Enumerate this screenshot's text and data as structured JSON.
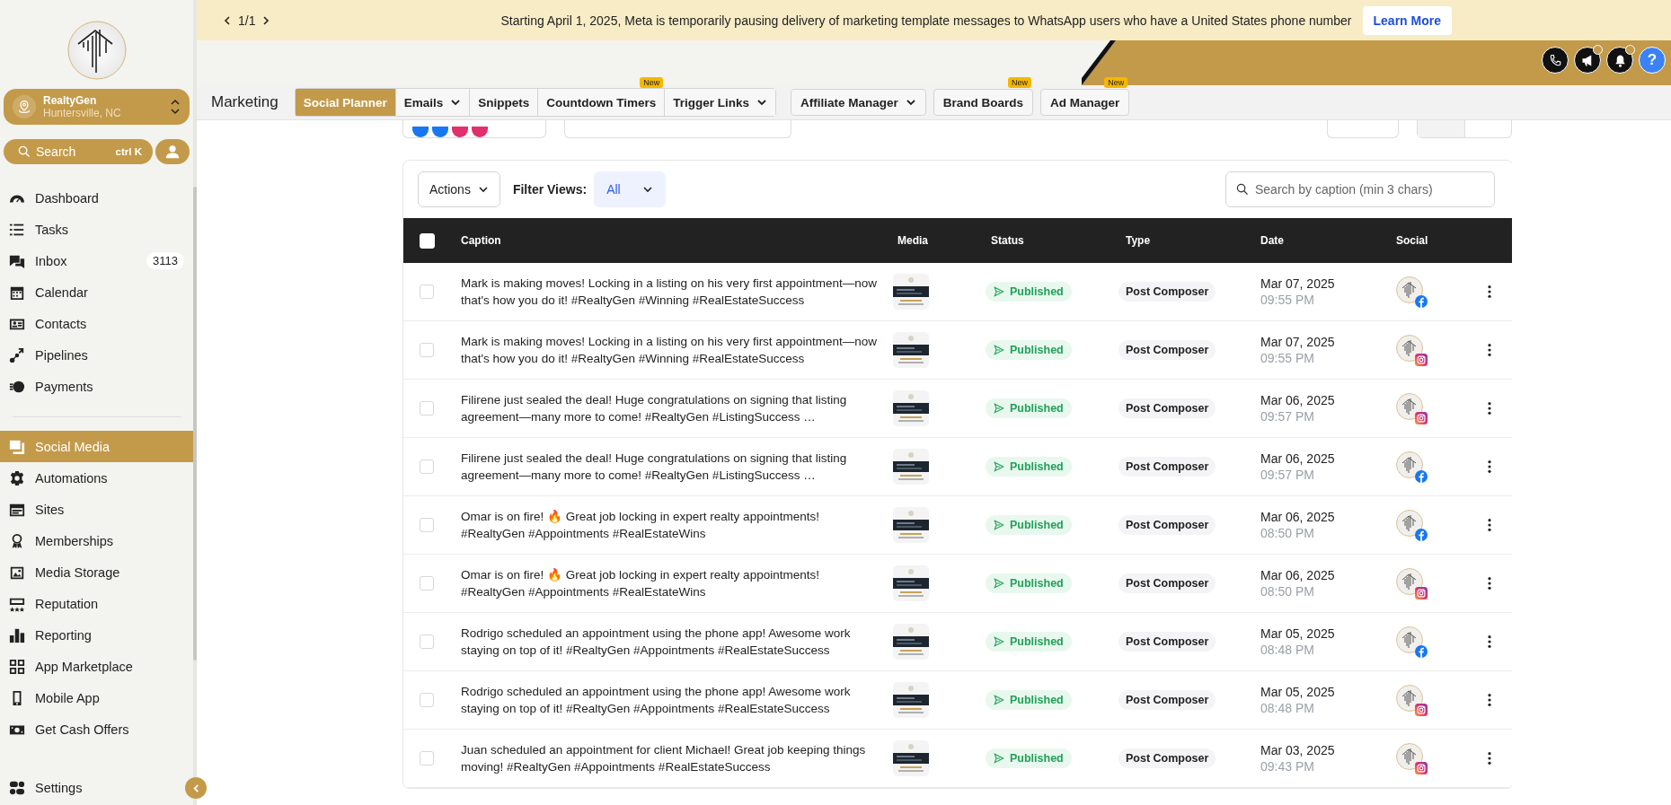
{
  "banner": {
    "pager": "1/1",
    "message": "Starting April 1, 2025, Meta is temporarily pausing delivery of marketing template messages to WhatsApp users who have a United States phone number",
    "button": "Learn More"
  },
  "sidebar": {
    "account": {
      "name": "RealtyGen",
      "location": "Huntersville, NC"
    },
    "search": {
      "placeholder": "Search",
      "shortcut": "ctrl K"
    },
    "main_items": [
      {
        "label": "Dashboard",
        "selected": false
      },
      {
        "label": "Tasks",
        "selected": false
      },
      {
        "label": "Inbox",
        "selected": false,
        "badge": "3113"
      },
      {
        "label": "Calendar",
        "selected": false
      },
      {
        "label": "Contacts",
        "selected": false
      },
      {
        "label": "Pipelines",
        "selected": false
      },
      {
        "label": "Payments",
        "selected": false
      }
    ],
    "more_items": [
      {
        "label": "Social Media",
        "selected": true
      },
      {
        "label": "Automations",
        "selected": false
      },
      {
        "label": "Sites",
        "selected": false
      },
      {
        "label": "Memberships",
        "selected": false
      },
      {
        "label": "Media Storage",
        "selected": false
      },
      {
        "label": "Reputation",
        "selected": false
      },
      {
        "label": "Reporting",
        "selected": false
      },
      {
        "label": "App Marketplace",
        "selected": false
      },
      {
        "label": "Mobile App",
        "selected": false
      },
      {
        "label": "Get Cash Offers",
        "selected": false
      }
    ],
    "settings": "Settings"
  },
  "header_icons": [
    {
      "kind": "phone",
      "dot": false
    },
    {
      "kind": "megaphone",
      "dot": true
    },
    {
      "kind": "bell",
      "dot": true
    },
    {
      "kind": "help",
      "label": "?"
    }
  ],
  "page_title": "Marketing",
  "tabs": [
    {
      "label": "Social Planner",
      "selected": true,
      "dropdown": false,
      "kind": "segment"
    },
    {
      "label": "Emails",
      "selected": false,
      "dropdown": true,
      "kind": "segment"
    },
    {
      "label": "Snippets",
      "selected": false,
      "dropdown": false,
      "kind": "segment"
    },
    {
      "label": "Countdown Timers",
      "selected": false,
      "dropdown": false,
      "kind": "segment",
      "badge": "New"
    },
    {
      "label": "Trigger Links",
      "selected": false,
      "dropdown": true,
      "kind": "segment"
    },
    {
      "label": "Affiliate Manager",
      "selected": false,
      "dropdown": true,
      "kind": "button"
    },
    {
      "label": "Brand Boards",
      "selected": false,
      "dropdown": false,
      "kind": "button",
      "badge": "New"
    },
    {
      "label": "Ad Manager",
      "selected": false,
      "dropdown": false,
      "kind": "button",
      "badge": "New"
    }
  ],
  "toolbar": {
    "actions": "Actions",
    "filter_label": "Filter Views:",
    "filter_value": "All",
    "search_placeholder": "Search by caption (min 3 chars)"
  },
  "table": {
    "header_checked": false,
    "columns": [
      "Caption",
      "Media",
      "Status",
      "Type",
      "Date",
      "Social"
    ],
    "rows": [
      {
        "checked": false,
        "caption": "Mark is making moves! Locking in a listing on his very first appointment—now that's how you do it! #RealtyGen #Winning #RealEstateSuccess",
        "status": "Published",
        "type": "Post Composer",
        "date": "Mar 07, 2025",
        "time": "09:55 PM",
        "kind": "facebook"
      },
      {
        "checked": false,
        "caption": "Mark is making moves! Locking in a listing on his very first appointment—now that's how you do it! #RealtyGen #Winning #RealEstateSuccess",
        "status": "Published",
        "type": "Post Composer",
        "date": "Mar 07, 2025",
        "time": "09:55 PM",
        "kind": "instagram"
      },
      {
        "checked": false,
        "caption": "Filirene just sealed the deal! Huge congratulations on signing that listing agreement—many more to come! #RealtyGen #ListingSuccess …",
        "status": "Published",
        "type": "Post Composer",
        "date": "Mar 06, 2025",
        "time": "09:57 PM",
        "kind": "instagram"
      },
      {
        "checked": false,
        "caption": "Filirene just sealed the deal! Huge congratulations on signing that listing agreement—many more to come! #RealtyGen #ListingSuccess …",
        "status": "Published",
        "type": "Post Composer",
        "date": "Mar 06, 2025",
        "time": "09:57 PM",
        "kind": "facebook"
      },
      {
        "checked": false,
        "caption": "Omar is on fire! 🔥 Great job locking in expert realty appointments! #RealtyGen #Appointments #RealEstateWins",
        "status": "Published",
        "type": "Post Composer",
        "date": "Mar 06, 2025",
        "time": "08:50 PM",
        "kind": "facebook"
      },
      {
        "checked": false,
        "caption": "Omar is on fire! 🔥 Great job locking in expert realty appointments! #RealtyGen #Appointments #RealEstateWins",
        "status": "Published",
        "type": "Post Composer",
        "date": "Mar 06, 2025",
        "time": "08:50 PM",
        "kind": "instagram"
      },
      {
        "checked": false,
        "caption": "Rodrigo scheduled an appointment using the phone app! Awesome work staying on top of it! #RealtyGen #Appointments #RealEstateSuccess",
        "status": "Published",
        "type": "Post Composer",
        "date": "Mar 05, 2025",
        "time": "08:48 PM",
        "kind": "facebook"
      },
      {
        "checked": false,
        "caption": "Rodrigo scheduled an appointment using the phone app! Awesome work staying on top of it! #RealtyGen #Appointments #RealEstateSuccess",
        "status": "Published",
        "type": "Post Composer",
        "date": "Mar 05, 2025",
        "time": "08:48 PM",
        "kind": "instagram"
      },
      {
        "checked": false,
        "caption": "Juan scheduled an appointment for client Michael! Great job keeping things moving! #RealtyGen #Appointments #RealEstateSuccess",
        "status": "Published",
        "type": "Post Composer",
        "date": "Mar 03, 2025",
        "time": "09:43 PM",
        "kind": "instagram"
      }
    ]
  }
}
